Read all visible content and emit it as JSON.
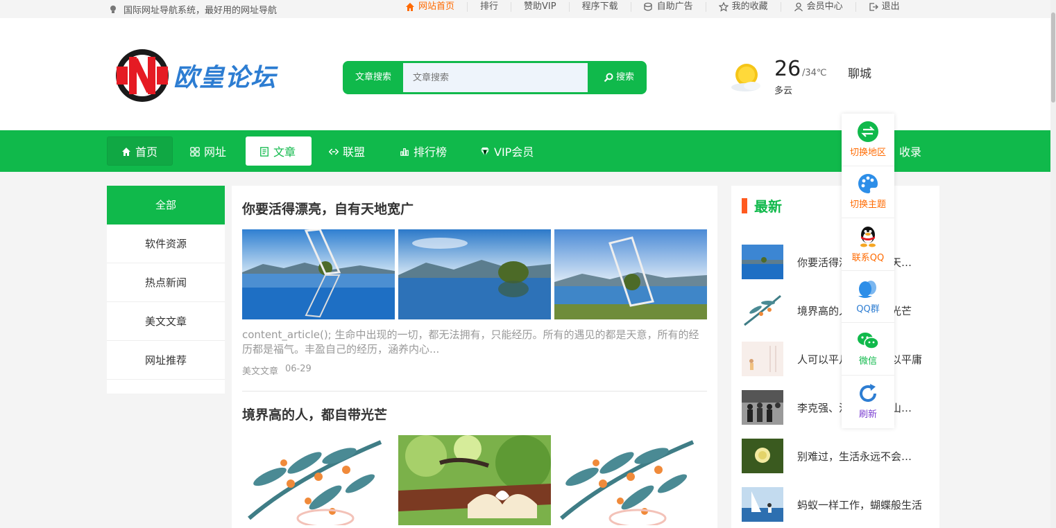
{
  "topbar": {
    "slogan": "国际网址导航系统，最好用的网址导航",
    "links": [
      {
        "label": "网站首页",
        "icon": "home-icon"
      },
      {
        "label": "排行",
        "icon": ""
      },
      {
        "label": "赞助VIP",
        "icon": ""
      },
      {
        "label": "程序下载",
        "icon": ""
      },
      {
        "label": "自助广告",
        "icon": "coins-icon"
      },
      {
        "label": "我的收藏",
        "icon": "star-icon"
      },
      {
        "label": "会员中心",
        "icon": "user-icon"
      },
      {
        "label": "退出",
        "icon": "logout-icon"
      }
    ]
  },
  "logo": {
    "text": "欧皇论坛"
  },
  "search": {
    "category": "文章搜索",
    "placeholder": "文章搜索",
    "button": "搜索"
  },
  "weather": {
    "temp": "26",
    "range": "/34℃",
    "city": "聊城",
    "condition": "多云"
  },
  "nav": {
    "items": [
      {
        "label": "首页"
      },
      {
        "label": "网址"
      },
      {
        "label": "文章"
      },
      {
        "label": "联盟"
      },
      {
        "label": "排行榜"
      },
      {
        "label": "VIP会员"
      },
      {
        "label": "收录"
      }
    ]
  },
  "categories": [
    "全部",
    "软件资源",
    "热点新闻",
    "美文文章",
    "网址推荐"
  ],
  "articles": [
    {
      "title": "你要活得漂亮，自有天地宽广",
      "summary": "content_article();              生命中出现的一切，都无法拥有，只能经历。所有的遇见的都是天意，所有的经历都是福气。丰盈自己的经历，涵养内心...",
      "category": "美文文章",
      "date": "06-29"
    },
    {
      "title": "境界高的人，都自带光芒"
    }
  ],
  "latest": {
    "title": "最新",
    "items": [
      "你要活得漂亮，自有天地宽广",
      "境界高的人，都自带光芒",
      "人可以平凡，但不可以平庸",
      "李克强、汪洋、王岐山、赵乐际、王毅",
      "别难过，生活永远不会亏待你",
      "蚂蚁一样工作，蝴蝶般生活"
    ]
  },
  "float_panel": [
    {
      "label": "切换地区",
      "color": "#ff6a00"
    },
    {
      "label": "切换主题",
      "color": "#ff6a00"
    },
    {
      "label": "联系QQ",
      "color": "#ff6a00"
    },
    {
      "label": "QQ群",
      "color": "#2d7dd2"
    },
    {
      "label": "微信",
      "color": "#10b94b"
    },
    {
      "label": "刷新",
      "color": "#7b3fd1"
    }
  ],
  "colors": {
    "accent": "#10b94b",
    "orange": "#ff6a00",
    "latest_bar": "#ff5a1f"
  }
}
